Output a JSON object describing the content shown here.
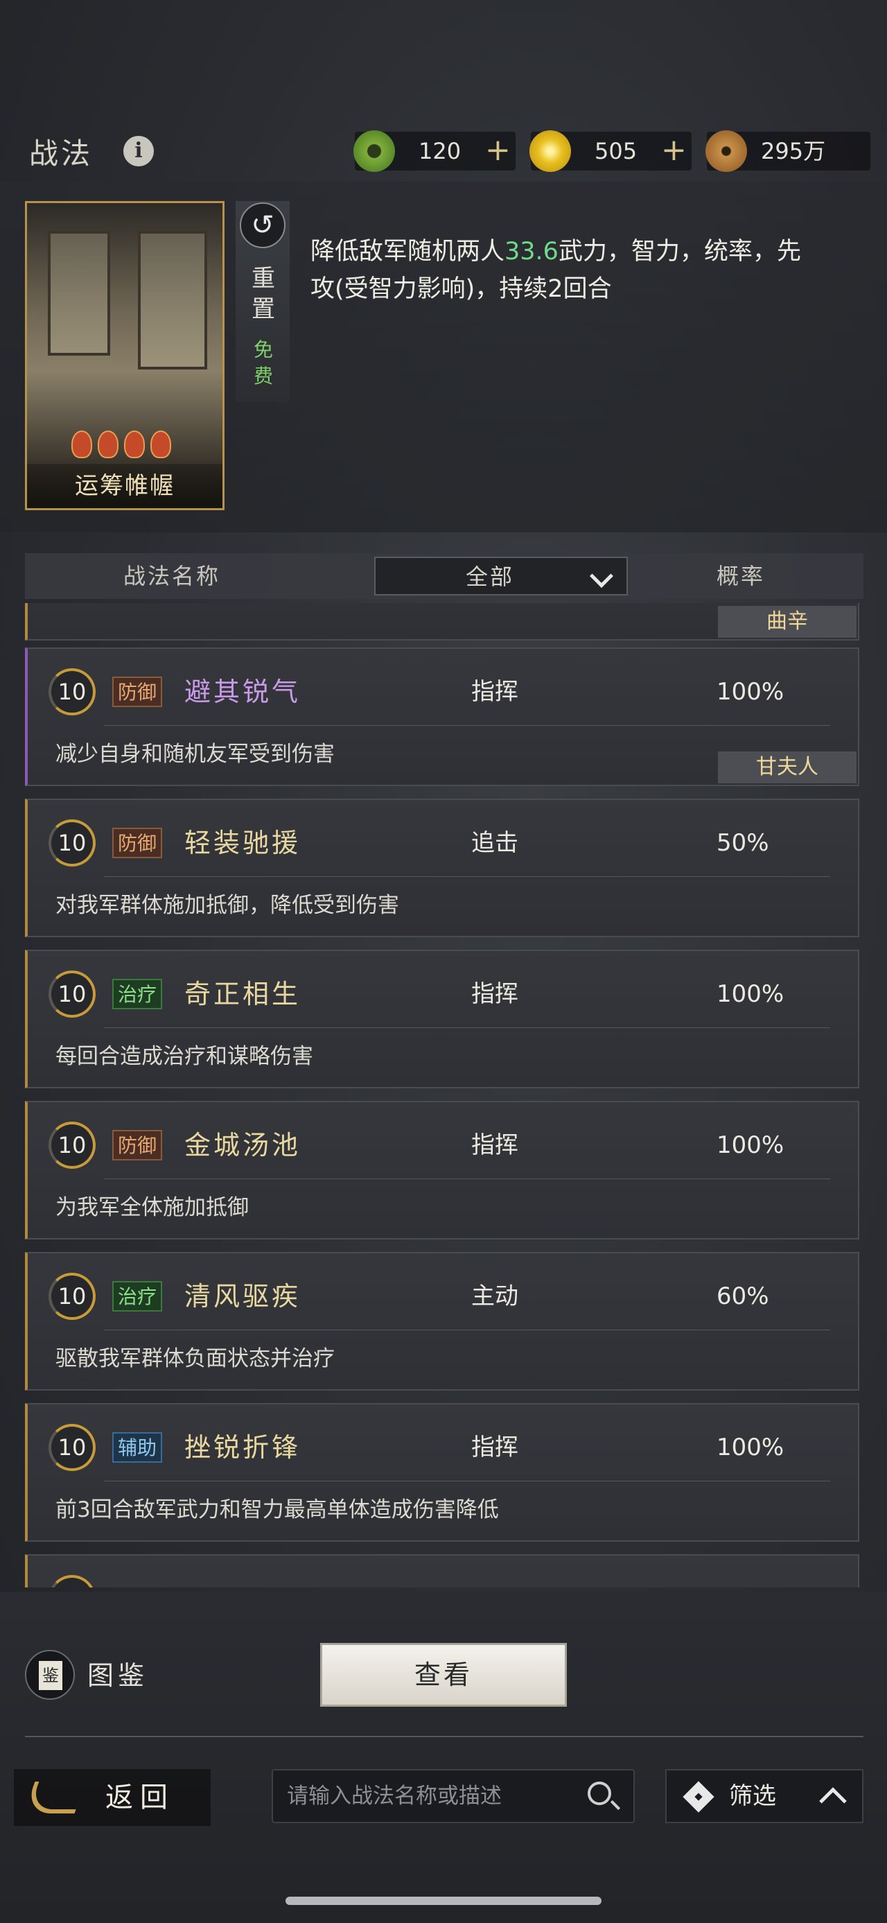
{
  "header": {
    "title": "战法",
    "currencies": [
      {
        "icon": "jade-coin-icon",
        "value": "120"
      },
      {
        "icon": "gold-coin-icon",
        "value": "505"
      },
      {
        "icon": "copper-coin-icon",
        "value": "295万"
      }
    ],
    "plus": "+"
  },
  "selected": {
    "card_name": "运筹帷幄",
    "reset_label": "重置",
    "free_label": "免费",
    "desc_pre": "降低敌军随机两人",
    "desc_value": "33.6",
    "desc_post": "武力，智力，统率，先攻(受智力影响)，持续2回合"
  },
  "list_header": {
    "name_col": "战法名称",
    "filter_selected": "全部",
    "prob_col": "概率"
  },
  "partial_top_owner": "曲辛",
  "items": [
    {
      "level": "10",
      "tag": "防御",
      "name": "避其锐气",
      "type": "指挥",
      "prob": "100%",
      "desc": "减少自身和随机友军受到伤害",
      "owner": "甘夫人"
    },
    {
      "level": "10",
      "tag": "防御",
      "name": "轻装驰援",
      "type": "追击",
      "prob": "50%",
      "desc": "对我军群体施加抵御，降低受到伤害"
    },
    {
      "level": "10",
      "tag": "治疗",
      "name": "奇正相生",
      "type": "指挥",
      "prob": "100%",
      "desc": "每回合造成治疗和谋略伤害"
    },
    {
      "level": "10",
      "tag": "防御",
      "name": "金城汤池",
      "type": "指挥",
      "prob": "100%",
      "desc": "为我军全体施加抵御"
    },
    {
      "level": "10",
      "tag": "治疗",
      "name": "清风驱疾",
      "type": "主动",
      "prob": "60%",
      "desc": "驱散我军群体负面状态并治疗"
    },
    {
      "level": "10",
      "tag": "辅助",
      "name": "挫锐折锋",
      "type": "指挥",
      "prob": "100%",
      "desc": "前3回合敌军武力和智力最高单体造成伤害降低"
    }
  ],
  "bottom": {
    "atlas_icon_text": "鉴",
    "atlas_label": "图鉴",
    "view_button": "查看",
    "back_label": "返回",
    "search_placeholder": "请输入战法名称或描述",
    "filter_label": "筛选"
  },
  "colors": {
    "accent_gold": "#b8914a",
    "highlight_green": "#6fdc8c",
    "purple": "#8a5ab4"
  }
}
